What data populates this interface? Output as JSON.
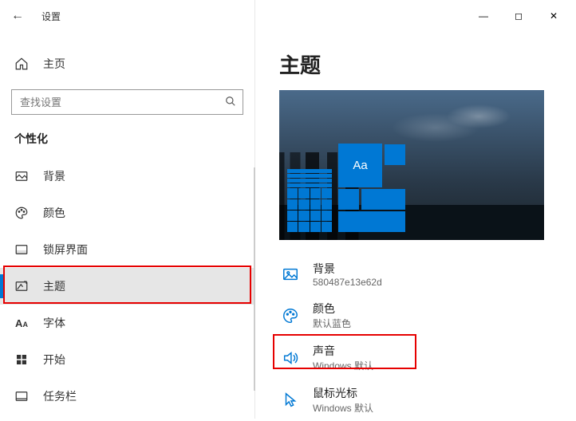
{
  "app": {
    "title": "设置"
  },
  "sidebar": {
    "home": "主页",
    "searchPlaceholder": "查找设置",
    "section": "个性化",
    "items": [
      {
        "label": "背景"
      },
      {
        "label": "颜色"
      },
      {
        "label": "锁屏界面"
      },
      {
        "label": "主题"
      },
      {
        "label": "字体"
      },
      {
        "label": "开始"
      },
      {
        "label": "任务栏"
      }
    ]
  },
  "main": {
    "title": "主题",
    "previewTile": "Aa",
    "options": [
      {
        "title": "背景",
        "sub": "580487e13e62d"
      },
      {
        "title": "颜色",
        "sub": "默认蓝色"
      },
      {
        "title": "声音",
        "sub": "Windows 默认"
      },
      {
        "title": "鼠标光标",
        "sub": "Windows 默认"
      }
    ]
  }
}
